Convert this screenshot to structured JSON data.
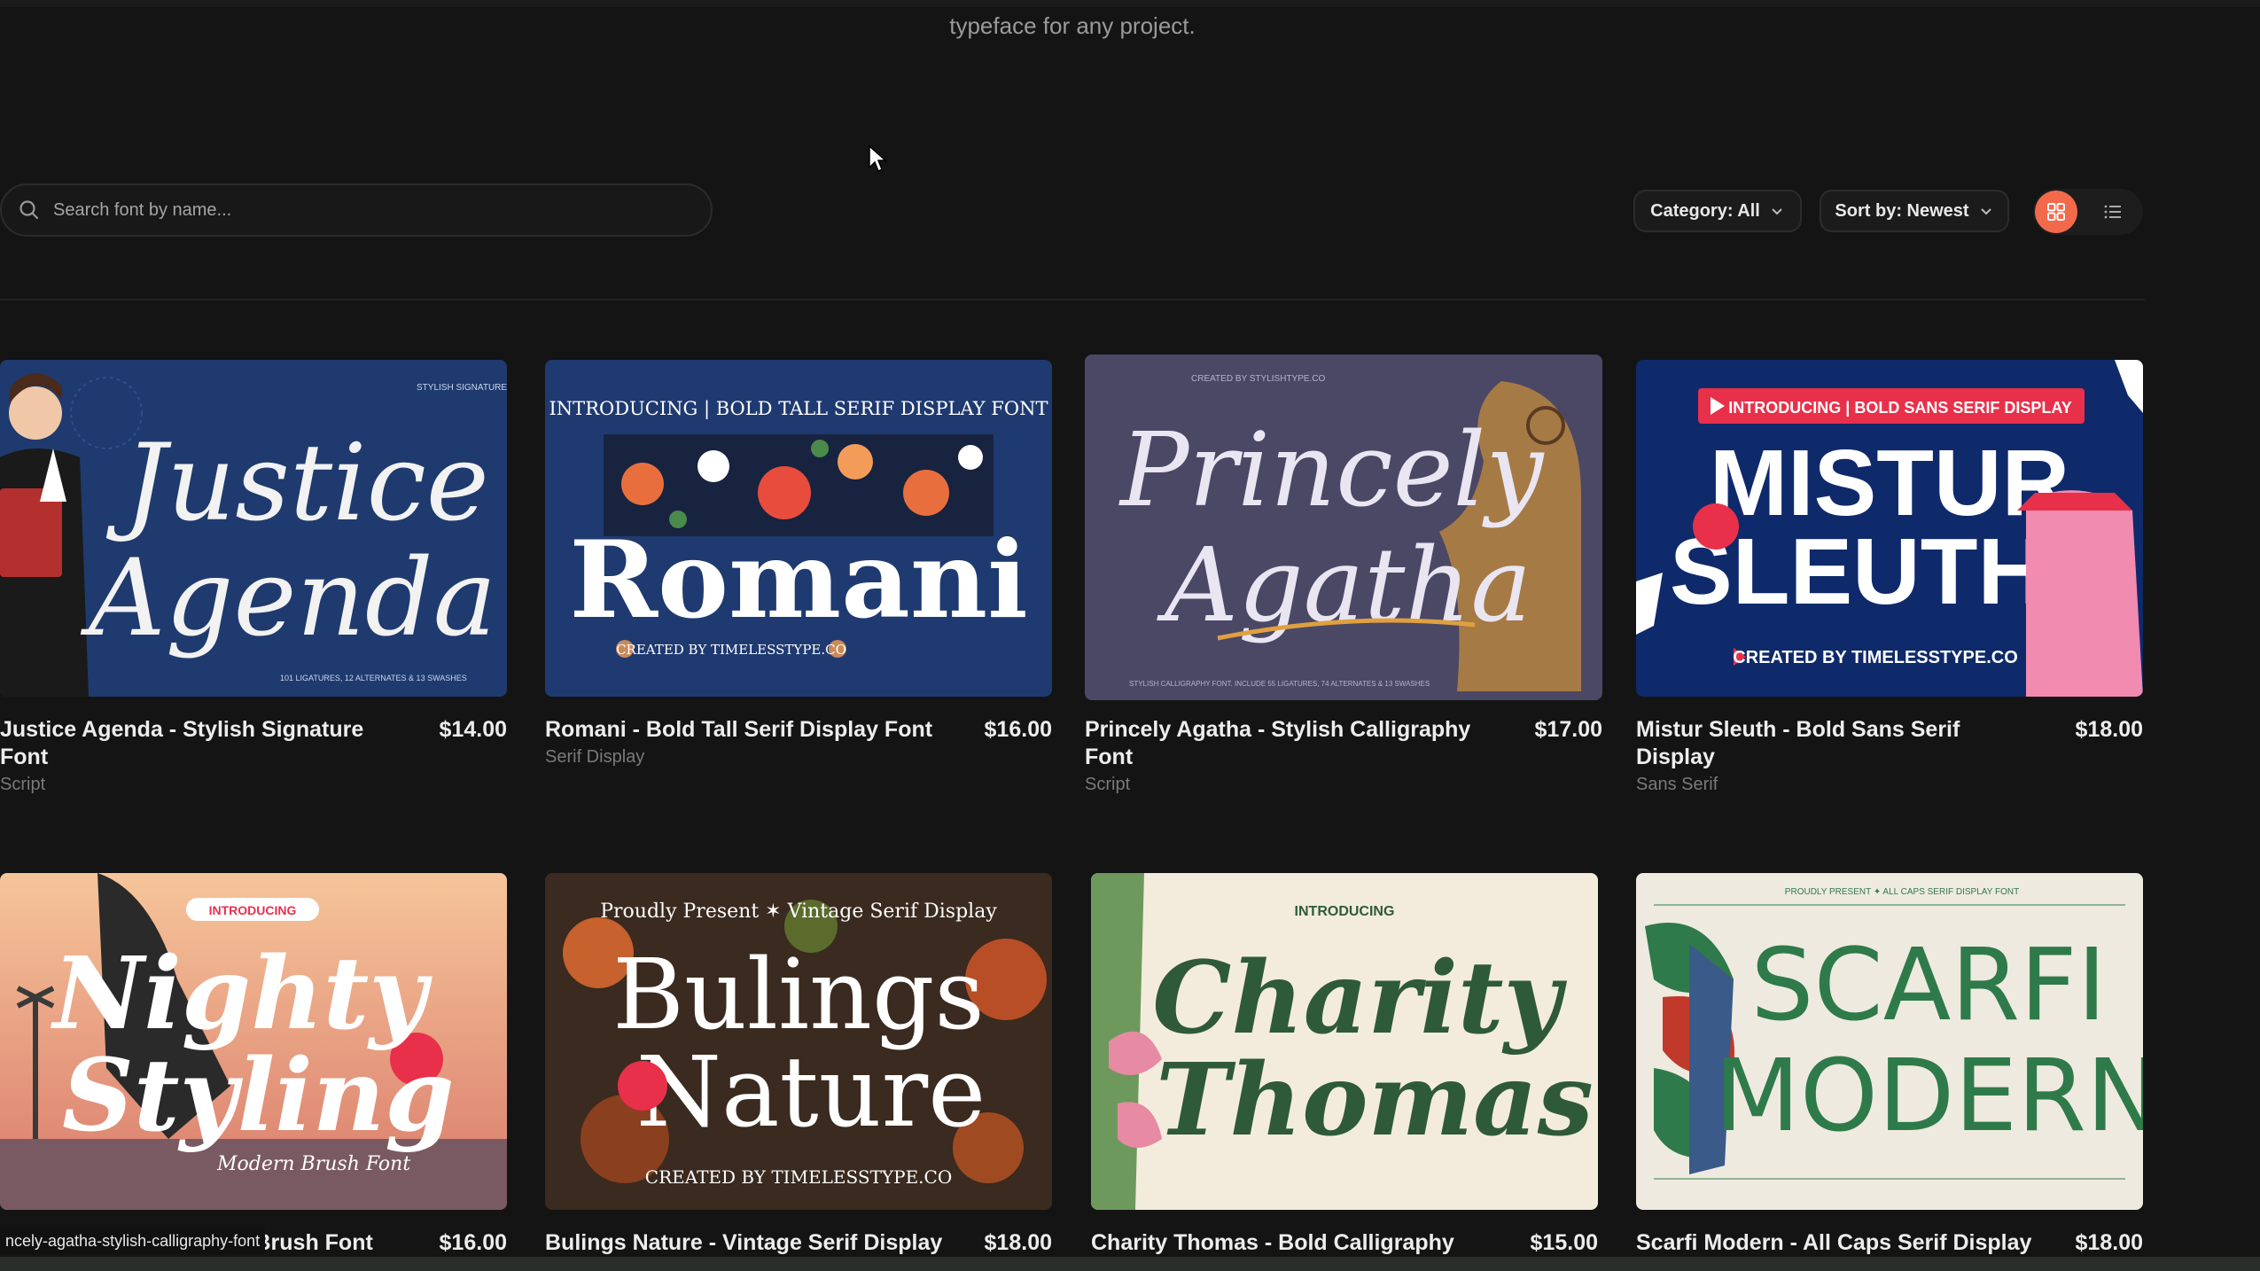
{
  "header": {
    "tagline": "typeface for any project."
  },
  "toolbar": {
    "search_placeholder": "Search font by name...",
    "category_label": "Category: All",
    "sort_label": "Sort by: Newest"
  },
  "accent_color": "#f26a4b",
  "fonts": [
    {
      "title": "Justice Agenda - Stylish Signature Font",
      "price": "$14.00",
      "category": "Script",
      "art": {
        "top": "STYLISH SIGNATURE FONT",
        "line1": "Justice",
        "line2": "Agenda",
        "bottom": "101 LIGATURES, 12 ALTERNATES & 13 SWASHES"
      }
    },
    {
      "title": "Romani - Bold Tall Serif Display Font",
      "price": "$16.00",
      "category": "Serif Display",
      "art": {
        "top": "INTRODUCING | BOLD TALL SERIF DISPLAY FONT",
        "line1": "Romani",
        "bottom": "CREATED BY TIMELESSTYPE.CO"
      }
    },
    {
      "title": "Princely Agatha - Stylish Calligraphy Font",
      "price": "$17.00",
      "category": "Script",
      "art": {
        "top": "CREATED BY STYLISHTYPE.CO",
        "line1": "Princely",
        "line2": "Agatha",
        "bottom": "STYLISH CALLIGRAPHY FONT. INCLUDE 55 LIGATURES, 74 ALTERNATES & 13 SWASHES"
      }
    },
    {
      "title": "Mistur Sleuth - Bold Sans Serif Display",
      "price": "$18.00",
      "category": "Sans Serif",
      "art": {
        "top": "INTRODUCING | BOLD SANS SERIF DISPLAY",
        "line1": "MISTUR",
        "line2": "SLEUTH",
        "bottom": "CREATED BY TIMELESSTYPE.CO"
      }
    },
    {
      "title": "Nighty Styling - Modern Brush Font",
      "price": "$16.00",
      "category": "",
      "art": {
        "top": "INTRODUCING",
        "line1": "Nighty",
        "line2": "Styling",
        "sub": "Modern Brush Font"
      }
    },
    {
      "title": "Bulings Nature - Vintage Serif Display",
      "price": "$18.00",
      "category": "",
      "art": {
        "top": "Proudly Present ✶ Vintage Serif Display",
        "line1": "Bulings",
        "line2": "Nature",
        "bottom": "CREATED BY TIMELESSTYPE.CO"
      }
    },
    {
      "title": "Charity Thomas - Bold Calligraphy",
      "price": "$15.00",
      "category": "",
      "art": {
        "top": "INTRODUCING",
        "line1": "Charity",
        "line2": "Thomas"
      }
    },
    {
      "title": "Scarfi Modern - All Caps Serif Display",
      "price": "$18.00",
      "category": "",
      "art": {
        "top": "PROUDLY PRESENT ✦ ALL CAPS SERIF DISPLAY FONT",
        "line1": "SCARFI",
        "line2": "MODERN"
      }
    }
  ],
  "status_tooltip": "ncely-agatha-stylish-calligraphy-font"
}
